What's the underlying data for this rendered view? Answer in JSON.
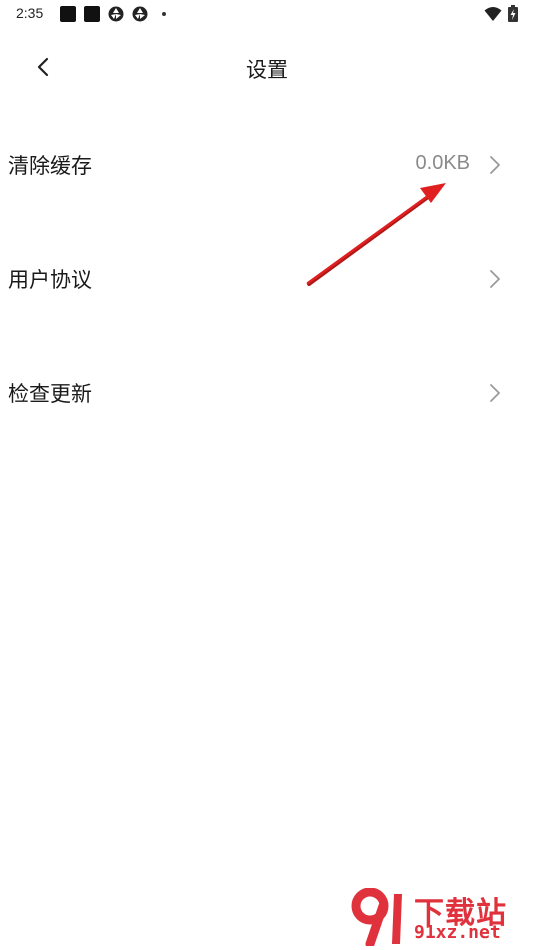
{
  "status_bar": {
    "time": "2:35",
    "icons": [
      "notification-square-icon",
      "notification-square-icon",
      "aperture-icon",
      "aperture-icon",
      "more-dot-icon",
      "wifi-icon",
      "battery-charging-icon"
    ]
  },
  "header": {
    "title": "设置",
    "back_icon": "chevron-left-icon"
  },
  "settings": {
    "items": [
      {
        "label": "清除缓存",
        "value": "0.0KB"
      },
      {
        "label": "用户协议",
        "value": ""
      },
      {
        "label": "检查更新",
        "value": ""
      }
    ]
  },
  "colors": {
    "annotation_arrow": "#e02020",
    "watermark": "#e0323c",
    "value_text": "#8a8a8a",
    "chevron": "#9a9a9a"
  },
  "watermark": {
    "title": "下载站",
    "url": "91xz.net",
    "logo_text": "91"
  }
}
